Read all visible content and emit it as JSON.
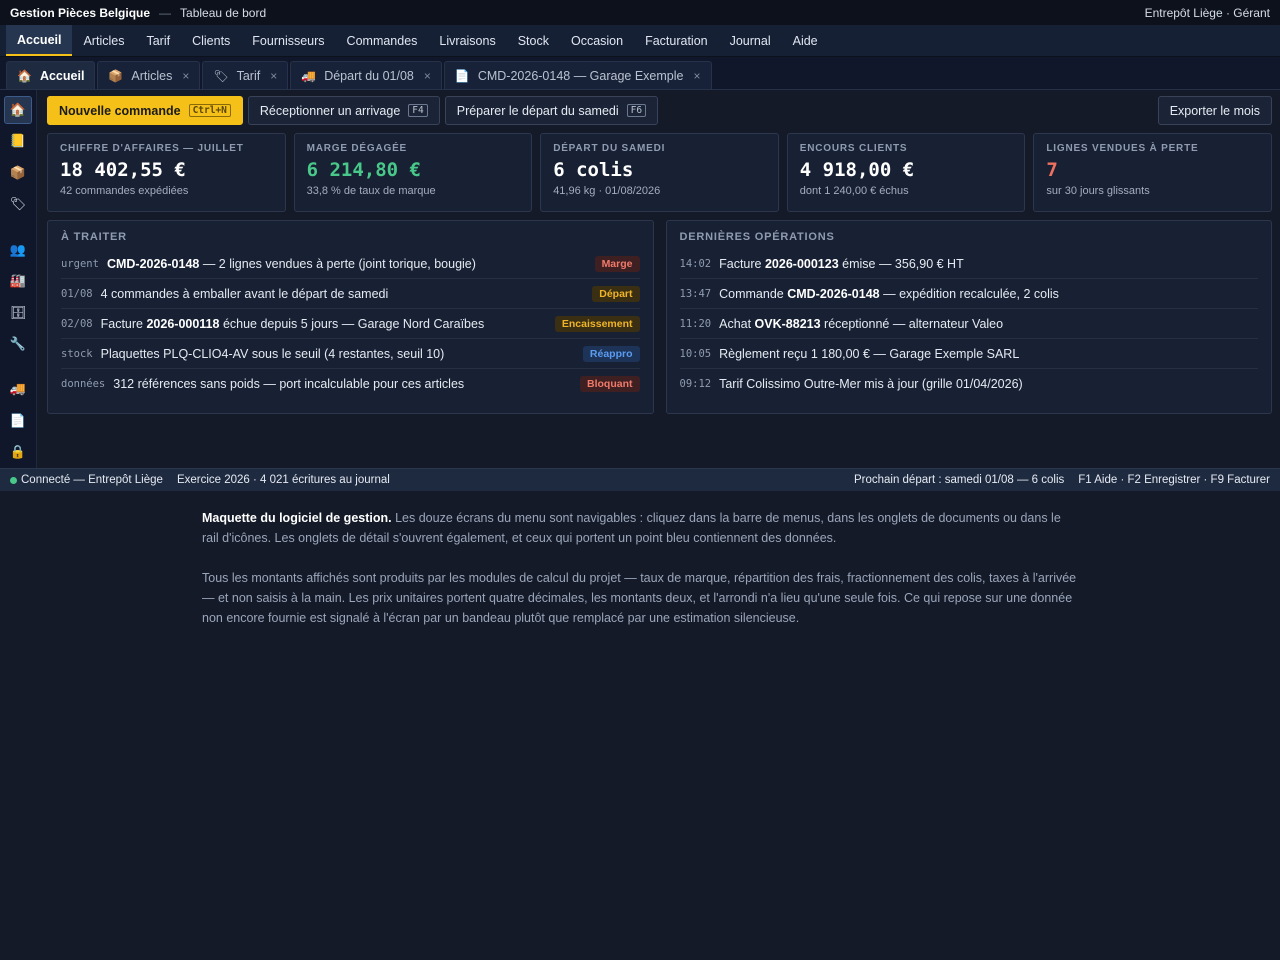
{
  "titlebar": {
    "app": "Gestion Pièces Belgique",
    "separator": "—",
    "subtitle": "Tableau de bord",
    "right": "Entrepôt Liège · Gérant"
  },
  "menu": [
    "Accueil",
    "Articles",
    "Tarif",
    "Clients",
    "Fournisseurs",
    "Commandes",
    "Livraisons",
    "Stock",
    "Occasion",
    "Facturation",
    "Journal",
    "Aide"
  ],
  "tabs": [
    {
      "icon": "🏠",
      "label": "Accueil",
      "closable": false
    },
    {
      "icon": "📦",
      "label": "Articles",
      "closable": true
    },
    {
      "icon": "🏷",
      "label": "Tarif",
      "closable": true
    },
    {
      "icon": "🚚",
      "label": "Départ du 01/08",
      "closable": true
    },
    {
      "icon": "📄",
      "label": "CMD-2026-0148 — Garage Exemple",
      "closable": true
    }
  ],
  "tab_close": "×",
  "rail": [
    "🏠",
    "📒",
    "📦",
    "🏷",
    "👥",
    "🏭",
    "🗄",
    "🔧",
    "🚚",
    "📄",
    "🔒"
  ],
  "actions": {
    "new_order": "Nouvelle commande",
    "new_order_key": "Ctrl+N",
    "receive": "Réceptionner un arrivage",
    "receive_key": "F4",
    "prepare": "Préparer le départ du samedi",
    "prepare_key": "F6",
    "export": "Exporter le mois"
  },
  "kpis": [
    {
      "label": "CHIFFRE D'AFFAIRES — JUILLET",
      "value": "18 402,55 €",
      "sub": "42 commandes expédiées",
      "tone": ""
    },
    {
      "label": "MARGE DÉGAGÉE",
      "value": "6 214,80 €",
      "sub": "33,8 % de taux de marque",
      "tone": "green"
    },
    {
      "label": "DÉPART DU SAMEDI",
      "value": "6 colis",
      "sub": "41,96 kg · 01/08/2026",
      "tone": ""
    },
    {
      "label": "ENCOURS CLIENTS",
      "value": "4 918,00 €",
      "sub": "dont 1 240,00 € échus",
      "tone": ""
    },
    {
      "label": "LIGNES VENDUES À PERTE",
      "value": "7",
      "sub": "sur 30 jours glissants",
      "tone": "red"
    }
  ],
  "todo": {
    "title": "À TRAITER",
    "rows": [
      {
        "tag": "urgent",
        "strong": "CMD-2026-0148",
        "pre": "",
        "text": " — 2 lignes vendues à perte (joint torique, bougie)",
        "badge": "Marge",
        "badge_color": "red"
      },
      {
        "tag": "01/08",
        "strong": "",
        "pre": "",
        "text": "4 commandes à emballer avant le départ de samedi",
        "badge": "Départ",
        "badge_color": "amber"
      },
      {
        "tag": "02/08",
        "strong": "2026-000118",
        "pre": "Facture ",
        "text": " échue depuis 5 jours — Garage Nord Caraïbes",
        "badge": "Encaissement",
        "badge_color": "amber"
      },
      {
        "tag": "stock",
        "strong": "",
        "pre": "",
        "text": "Plaquettes PLQ-CLIO4-AV sous le seuil (4 restantes, seuil 10)",
        "badge": "Réappro",
        "badge_color": "blue"
      },
      {
        "tag": "données",
        "strong": "",
        "pre": "",
        "text": "312 références sans poids — port incalculable pour ces articles",
        "badge": "Bloquant",
        "badge_color": "red"
      }
    ]
  },
  "ops": {
    "title": "DERNIÈRES OPÉRATIONS",
    "rows": [
      {
        "time": "14:02",
        "pre": "Facture ",
        "strong": "2026-000123",
        "text": " émise — 356,90 € HT"
      },
      {
        "time": "13:47",
        "pre": "Commande ",
        "strong": "CMD-2026-0148",
        "text": " — expédition recalculée, 2 colis"
      },
      {
        "time": "11:20",
        "pre": "Achat ",
        "strong": "OVK-88213",
        "text": " réceptionné — alternateur Valeo"
      },
      {
        "time": "10:05",
        "pre": "",
        "strong": "",
        "text": "Règlement reçu 1 180,00 € — Garage Exemple SARL"
      },
      {
        "time": "09:12",
        "pre": "",
        "strong": "",
        "text": "Tarif Colissimo Outre-Mer mis à jour (grille 01/04/2026)"
      }
    ]
  },
  "status": {
    "connected": "Connecté — Entrepôt Liège",
    "exercise": "Exercice 2026 · 4 021 écritures au journal",
    "next": "Prochain départ : samedi 01/08 — 6 colis",
    "keys": "F1 Aide · F2 Enregistrer · F9 Facturer"
  },
  "notes": {
    "p1_strong": "Maquette du logiciel de gestion.",
    "p1": " Les douze écrans du menu sont navigables : cliquez dans la barre de menus, dans les onglets de documents ou dans le rail d'icônes. Les onglets de détail s'ouvrent également, et ceux qui portent un point bleu contiennent des données.",
    "p2": "Tous les montants affichés sont produits par les modules de calcul du projet — taux de marque, répartition des frais, fractionnement des colis, taxes à l'arrivée — et non saisis à la main. Les prix unitaires portent quatre décimales, les montants deux, et l'arrondi n'a lieu qu'une seule fois. Ce qui repose sur une donnée non encore fournie est signalé à l'écran par un bandeau plutôt que remplacé par une estimation silencieuse."
  },
  "colors": {
    "accent": "#f5c118",
    "ok": "#48c98a",
    "danger": "#f07060",
    "info": "#5b9cf0"
  }
}
